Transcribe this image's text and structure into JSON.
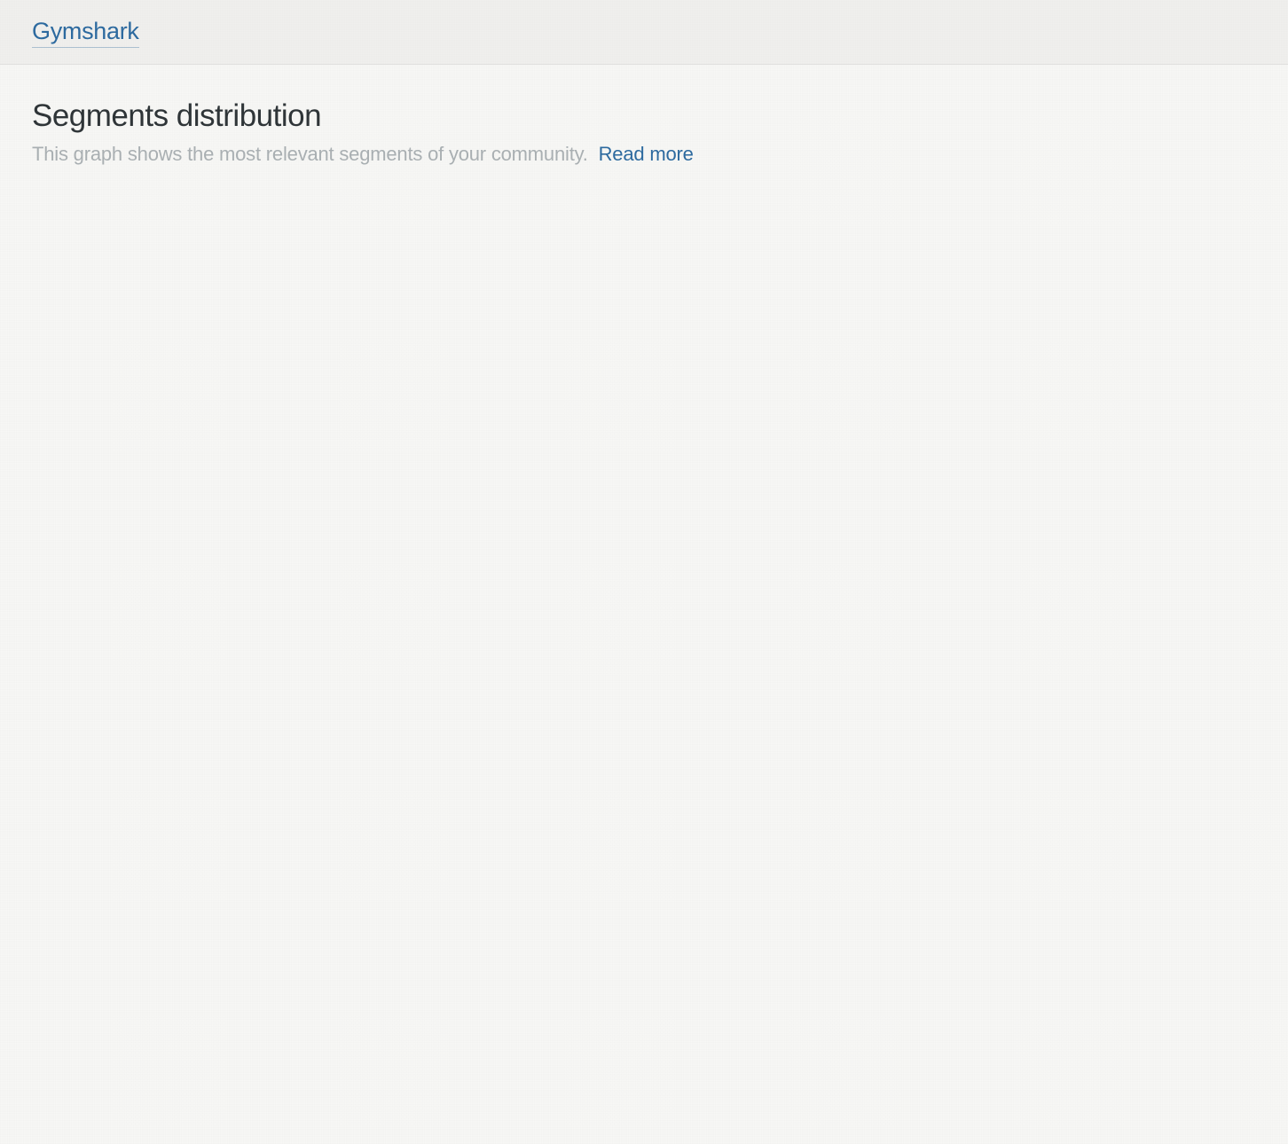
{
  "header": {
    "brand": "Gymshark"
  },
  "main": {
    "title": "Segments distribution",
    "description": "This graph shows the most relevant segments of your community.",
    "read_more": "Read more"
  }
}
